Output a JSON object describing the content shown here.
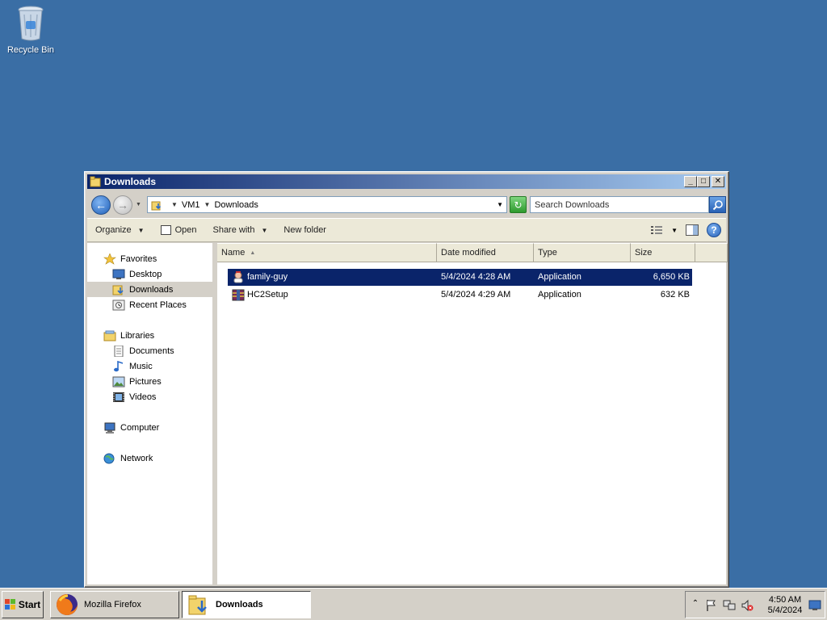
{
  "desktop": {
    "recycle_bin_label": "Recycle Bin"
  },
  "window": {
    "title": "Downloads",
    "controls": {
      "minimize": "_",
      "maximize": "□",
      "close": "✕"
    },
    "address": {
      "crumbs": [
        "VM1",
        "Downloads"
      ]
    },
    "search": {
      "placeholder": "Search Downloads"
    }
  },
  "toolbar": {
    "organize": "Organize",
    "open": "Open",
    "share_with": "Share with",
    "new_folder": "New folder",
    "help": "?"
  },
  "navpane": {
    "favorites": "Favorites",
    "desktop": "Desktop",
    "downloads": "Downloads",
    "recent_places": "Recent Places",
    "libraries": "Libraries",
    "documents": "Documents",
    "music": "Music",
    "pictures": "Pictures",
    "videos": "Videos",
    "computer": "Computer",
    "network": "Network"
  },
  "columns": {
    "name": "Name",
    "date_modified": "Date modified",
    "type": "Type",
    "size": "Size"
  },
  "files": [
    {
      "name": "family-guy",
      "date": "5/4/2024 4:28 AM",
      "type": "Application",
      "size": "6,650 KB"
    },
    {
      "name": "HC2Setup",
      "date": "5/4/2024 4:29 AM",
      "type": "Application",
      "size": "632 KB"
    }
  ],
  "taskbar": {
    "start": "Start",
    "firefox": "Mozilla Firefox",
    "downloads": "Downloads",
    "time": "4:50 AM",
    "date": "5/4/2024"
  },
  "colors": {
    "desktop": "#3a6ea5",
    "titlebar_start": "#0a246a",
    "titlebar_end": "#a6caf0",
    "selection": "#0a246a"
  }
}
